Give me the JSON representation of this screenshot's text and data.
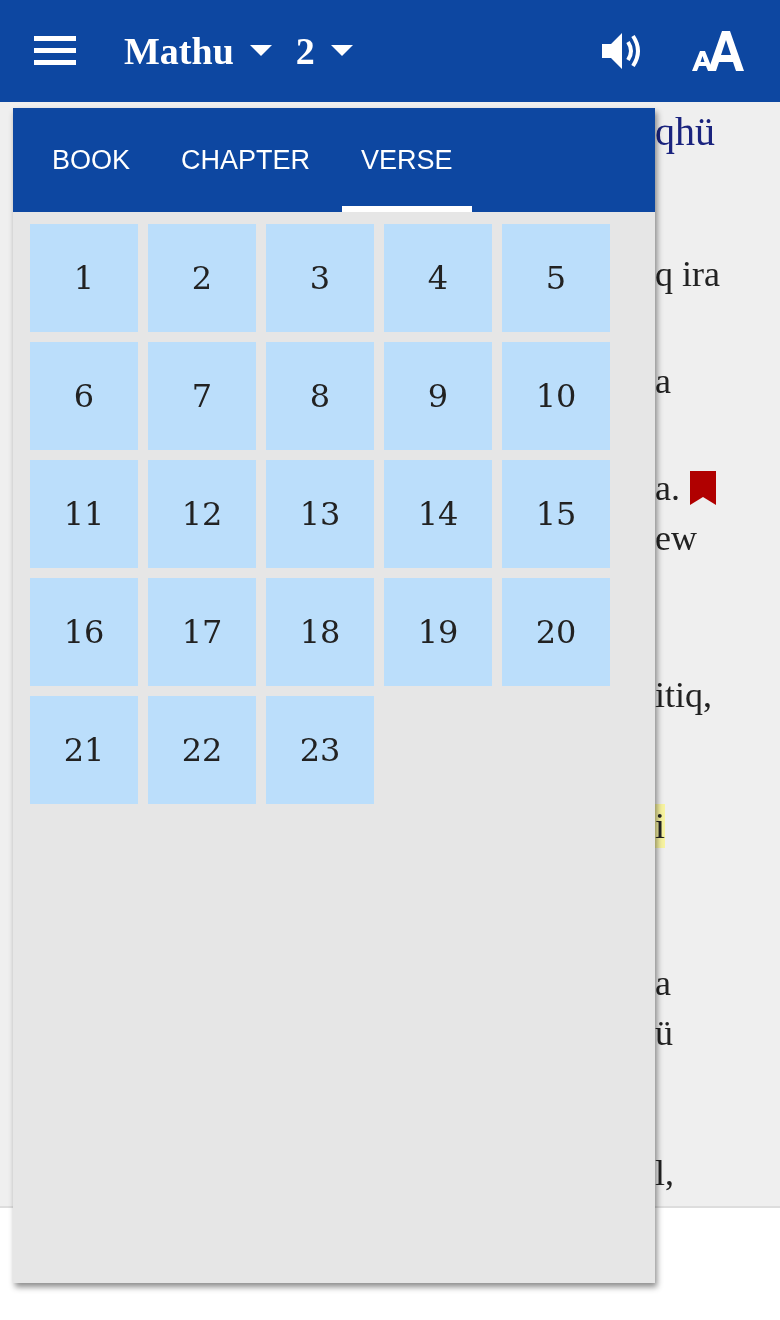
{
  "app_bar": {
    "book": "Mathu",
    "chapter": "2"
  },
  "reading_lines": [
    {
      "text": "qhü",
      "kind": "heading",
      "bookmark": false,
      "highlighted": false
    },
    {
      "text": "q ira",
      "kind": "verse",
      "bookmark": false,
      "highlighted": false
    },
    {
      "text": "a",
      "kind": "verse",
      "bookmark": false,
      "highlighted": false
    },
    {
      "text": "a.",
      "kind": "verse",
      "bookmark": true,
      "highlighted": false
    },
    {
      "text": "ew",
      "kind": "verse",
      "bookmark": false,
      "highlighted": false
    },
    {
      "text": "itiq,",
      "kind": "verse",
      "bookmark": false,
      "highlighted": false
    },
    {
      "text": "i",
      "kind": "verse",
      "bookmark": false,
      "highlighted": true
    },
    {
      "text": "a",
      "kind": "verse",
      "bookmark": false,
      "highlighted": false
    },
    {
      "text": "ü",
      "kind": "verse",
      "bookmark": false,
      "highlighted": false
    },
    {
      "text": "l,",
      "kind": "verse",
      "bookmark": false,
      "highlighted": false
    }
  ],
  "picker": {
    "tabs": [
      {
        "label": "BOOK",
        "selected": false
      },
      {
        "label": "CHAPTER",
        "selected": false
      },
      {
        "label": "VERSE",
        "selected": true
      }
    ],
    "verses": [
      "1",
      "2",
      "3",
      "4",
      "5",
      "6",
      "7",
      "8",
      "9",
      "10",
      "11",
      "12",
      "13",
      "14",
      "15",
      "16",
      "17",
      "18",
      "19",
      "20",
      "21",
      "22",
      "23"
    ]
  }
}
